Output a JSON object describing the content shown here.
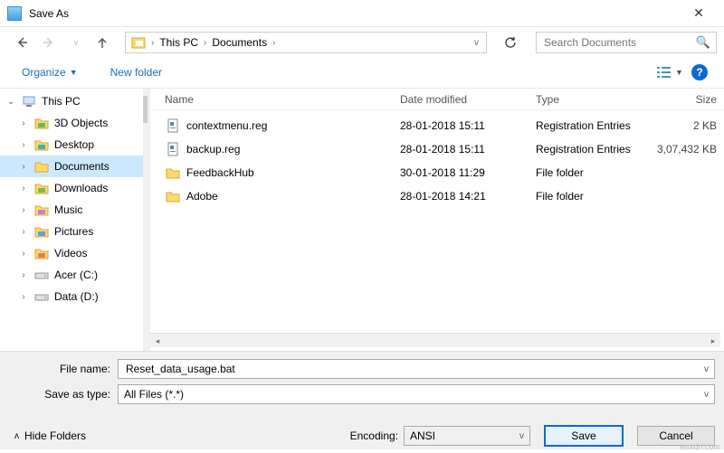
{
  "window": {
    "title": "Save As"
  },
  "nav": {
    "breadcrumb": [
      "This PC",
      "Documents"
    ],
    "search_placeholder": "Search Documents"
  },
  "toolbar": {
    "organize": "Organize",
    "new_folder": "New folder"
  },
  "sidebar": [
    {
      "label": "This PC",
      "icon": "pc",
      "expanded": true,
      "selected": false
    },
    {
      "label": "3D Objects",
      "icon": "folder-3d",
      "sub": true
    },
    {
      "label": "Desktop",
      "icon": "folder-teal",
      "sub": true
    },
    {
      "label": "Documents",
      "icon": "folder-doc",
      "sub": true,
      "selected": true
    },
    {
      "label": "Downloads",
      "icon": "folder-dl",
      "sub": true
    },
    {
      "label": "Music",
      "icon": "folder-music",
      "sub": true
    },
    {
      "label": "Pictures",
      "icon": "folder-pic",
      "sub": true
    },
    {
      "label": "Videos",
      "icon": "folder-vid",
      "sub": true
    },
    {
      "label": "Acer (C:)",
      "icon": "drive",
      "sub": true
    },
    {
      "label": "Data (D:)",
      "icon": "drive",
      "sub": true
    }
  ],
  "columns": {
    "name": "Name",
    "date": "Date modified",
    "type": "Type",
    "size": "Size"
  },
  "files": [
    {
      "name": "contextmenu.reg",
      "date": "28-01-2018 15:11",
      "type": "Registration Entries",
      "size": "2 KB",
      "icon": "reg"
    },
    {
      "name": "backup.reg",
      "date": "28-01-2018 15:11",
      "type": "Registration Entries",
      "size": "3,07,432 KB",
      "icon": "reg"
    },
    {
      "name": "FeedbackHub",
      "date": "30-01-2018 11:29",
      "type": "File folder",
      "size": "",
      "icon": "folder"
    },
    {
      "name": "Adobe",
      "date": "28-01-2018 14:21",
      "type": "File folder",
      "size": "",
      "icon": "folder"
    }
  ],
  "form": {
    "filename_label": "File name:",
    "filename_value": "Reset_data_usage.bat",
    "type_label": "Save as type:",
    "type_value": "All Files (*.*)"
  },
  "footer": {
    "hide_folders": "Hide Folders",
    "encoding_label": "Encoding:",
    "encoding_value": "ANSI",
    "save": "Save",
    "cancel": "Cancel"
  },
  "watermark": "wsxdn.com"
}
